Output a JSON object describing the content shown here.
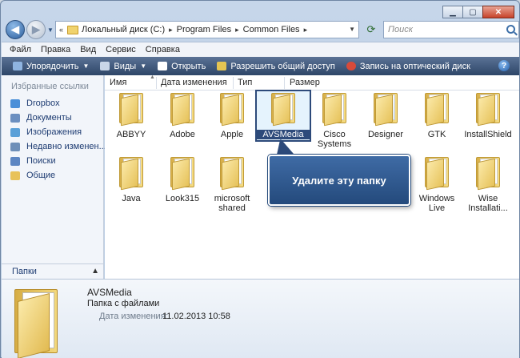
{
  "window": {
    "caption_buttons": [
      "minimize",
      "maximize",
      "close"
    ]
  },
  "address": {
    "breadcrumbs": [
      "Локальный диск (C:)",
      "Program Files",
      "Common Files"
    ],
    "search_placeholder": "Поиск"
  },
  "menu": [
    "Файл",
    "Правка",
    "Вид",
    "Сервис",
    "Справка"
  ],
  "commands": [
    {
      "label": "Упорядочить",
      "icon": "organize-icon",
      "color": "#8fb4e0",
      "dropdown": true
    },
    {
      "label": "Виды",
      "icon": "views-icon",
      "color": "#c9d6e8",
      "dropdown": true
    },
    {
      "label": "Открыть",
      "icon": "open-icon",
      "color": "#ffffff",
      "dropdown": false
    },
    {
      "label": "Разрешить общий доступ",
      "icon": "share-icon",
      "color": "#e6c552",
      "dropdown": false
    },
    {
      "label": "Запись на оптический диск",
      "icon": "burn-disc-icon",
      "color": "#d84a3a",
      "dropdown": false
    }
  ],
  "nav": {
    "header": "Избранные ссылки",
    "favorites": [
      {
        "label": "Dropbox",
        "color": "#4a8fd8"
      },
      {
        "label": "Документы",
        "color": "#6b8fc0"
      },
      {
        "label": "Изображения",
        "color": "#5aa0d8"
      },
      {
        "label": "Недавно изменен...",
        "color": "#6e8fb8"
      },
      {
        "label": "Поиски",
        "color": "#5d86c2"
      },
      {
        "label": "Общие",
        "color": "#e8c25a"
      }
    ],
    "folders_label": "Папки"
  },
  "columns": [
    "Имя",
    "Дата изменения",
    "Тип",
    "Размер"
  ],
  "folders": [
    {
      "name": "ABBYY",
      "doc": false
    },
    {
      "name": "Adobe",
      "doc": false
    },
    {
      "name": "Apple",
      "doc": false
    },
    {
      "name": "AVSMedia",
      "doc": false,
      "selected": true
    },
    {
      "name": "Cisco Systems",
      "doc": false
    },
    {
      "name": "Designer",
      "doc": true
    },
    {
      "name": "GTK",
      "doc": false
    },
    {
      "name": "InstallShield",
      "doc": false
    },
    {
      "name": "Java",
      "doc": false
    },
    {
      "name": "Look315",
      "doc": false
    },
    {
      "name": "microsoft shared",
      "doc": false
    },
    {
      "name": "",
      "doc": false,
      "hidden": true
    },
    {
      "name": "",
      "doc": false,
      "hidden": true
    },
    {
      "name": "",
      "doc": false,
      "hidden": true
    },
    {
      "name": "Windows Live",
      "doc": false
    },
    {
      "name": "Wise Installati...",
      "doc": false
    }
  ],
  "callout": "Удалите эту папку",
  "details": {
    "name": "AVSMedia",
    "type": "Папка с файлами",
    "date_label": "Дата изменения:",
    "date_value": "11.02.2013 10:58"
  }
}
